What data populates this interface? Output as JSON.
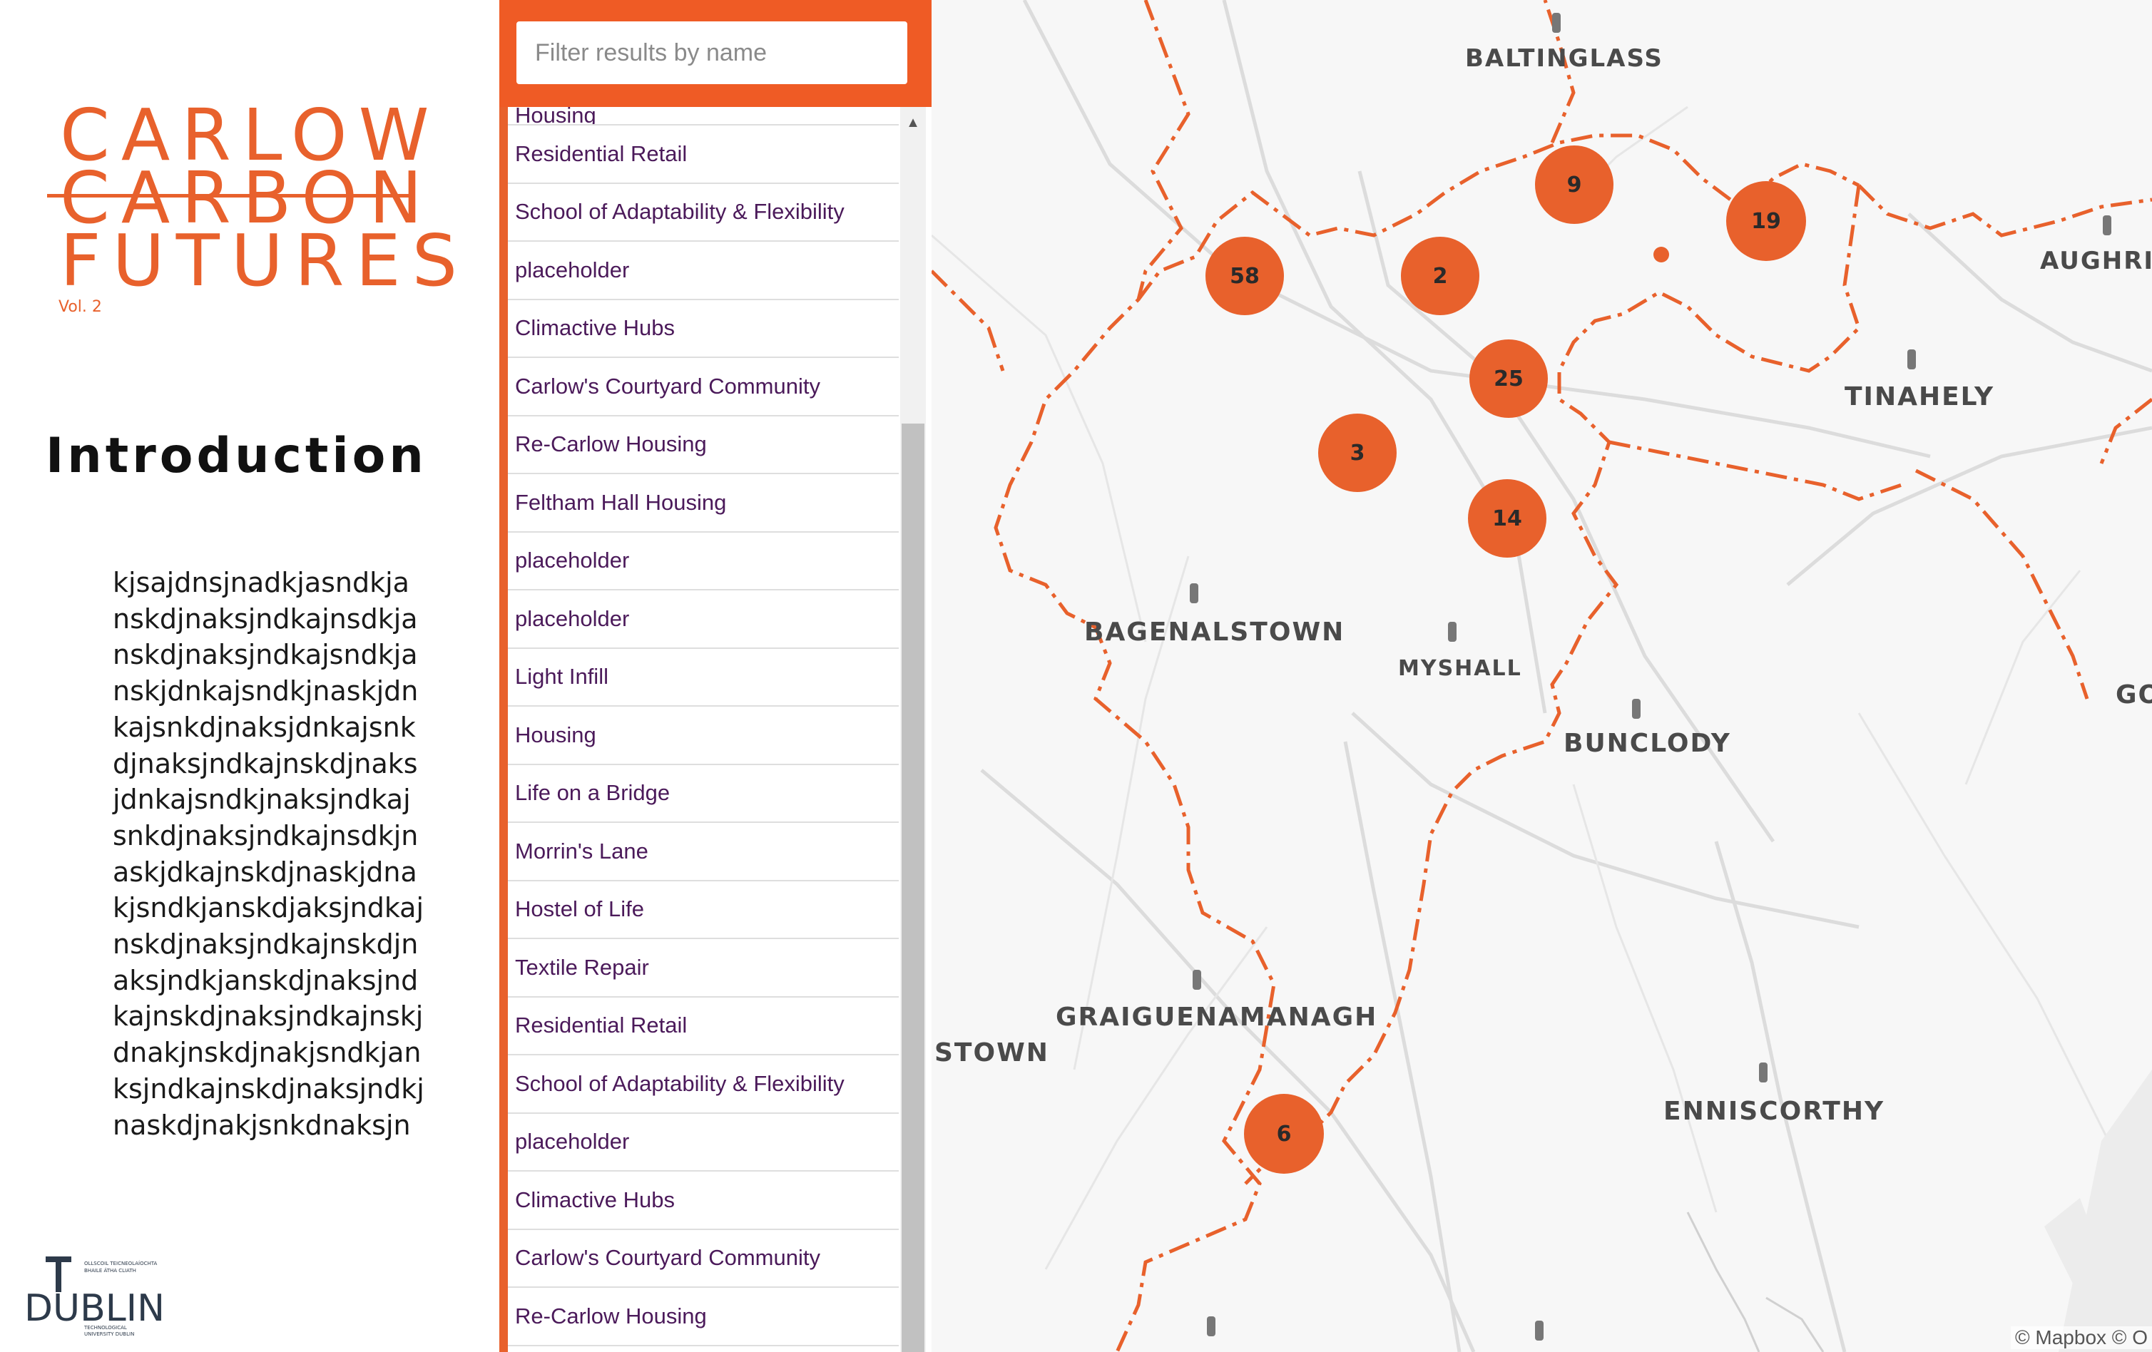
{
  "branding": {
    "line1": "CARLOW",
    "line2": "CARBON",
    "line3": "FUTURES",
    "volume": "Vol. 2",
    "accent_color": "#e8612c"
  },
  "intro": {
    "heading": "Introduction",
    "body_lines": [
      "kjsajdnsjnadkjasndkja",
      "nskdjnaksjndkajnsdkja",
      "nskdjnaksjndkajsndkja",
      "nskjdnkajsndkjnaskjdn",
      "kajsnkdjnaksjdnkajsnk",
      "djnaksjndkajnskdjnaks",
      "jdnkajsndkjnaksjndkaj",
      "snkdjnaksjndkajnsdkjn",
      "askjdkajnskdjnaskjdna",
      "kjsndkjanskdjaksjndkaj",
      "nskdjnaksjndkajnskdjn",
      "aksjndkjanskdjnaksjnd",
      "kajnskdjnaksjndkajnskj",
      "dnakjnskdjnakjsndkjan",
      "ksjndkajnskdjnaksjndkj",
      "naskdjnakjsnkdnaksjn"
    ]
  },
  "logo": {
    "main_text": "DUBLIN",
    "letter": "T",
    "small_text_1": "OLLSCOIL TEICNEOLAÍOCHTA",
    "small_text_2": "BHAILE ÁTHA CLIATH",
    "small_text_3": "TECHNOLOGICAL",
    "small_text_4": "UNIVERSITY DUBLIN"
  },
  "filter": {
    "placeholder": "Filter results by name"
  },
  "results": [
    "Housing",
    "Residential Retail",
    "School of Adaptability & Flexibility",
    "placeholder",
    "Climactive Hubs",
    "Carlow's Courtyard Community",
    "Re-Carlow Housing",
    "Feltham Hall Housing",
    "placeholder",
    "placeholder",
    "Light Infill",
    "Housing",
    "Life on a Bridge",
    "Morrin's Lane",
    "Hostel of Life",
    "Textile Repair",
    "Residential Retail",
    "School of Adaptability & Flexibility",
    "placeholder",
    "Climactive Hubs",
    "Carlow's Courtyard Community",
    "Re-Carlow Housing"
  ],
  "map": {
    "towns": [
      "BALTINGLASS",
      "AUGHRI",
      "TINAHELY",
      "BAGENALSTOWN",
      "MYSHALL",
      "BUNCLODY",
      "GO",
      "GRAIGUENAMANAGH",
      "STOWN",
      "ENNISCORTHY"
    ],
    "clusters": [
      "58",
      "2",
      "9",
      "19",
      "25",
      "3",
      "14",
      "6"
    ],
    "attribution": "© Mapbox © O"
  }
}
